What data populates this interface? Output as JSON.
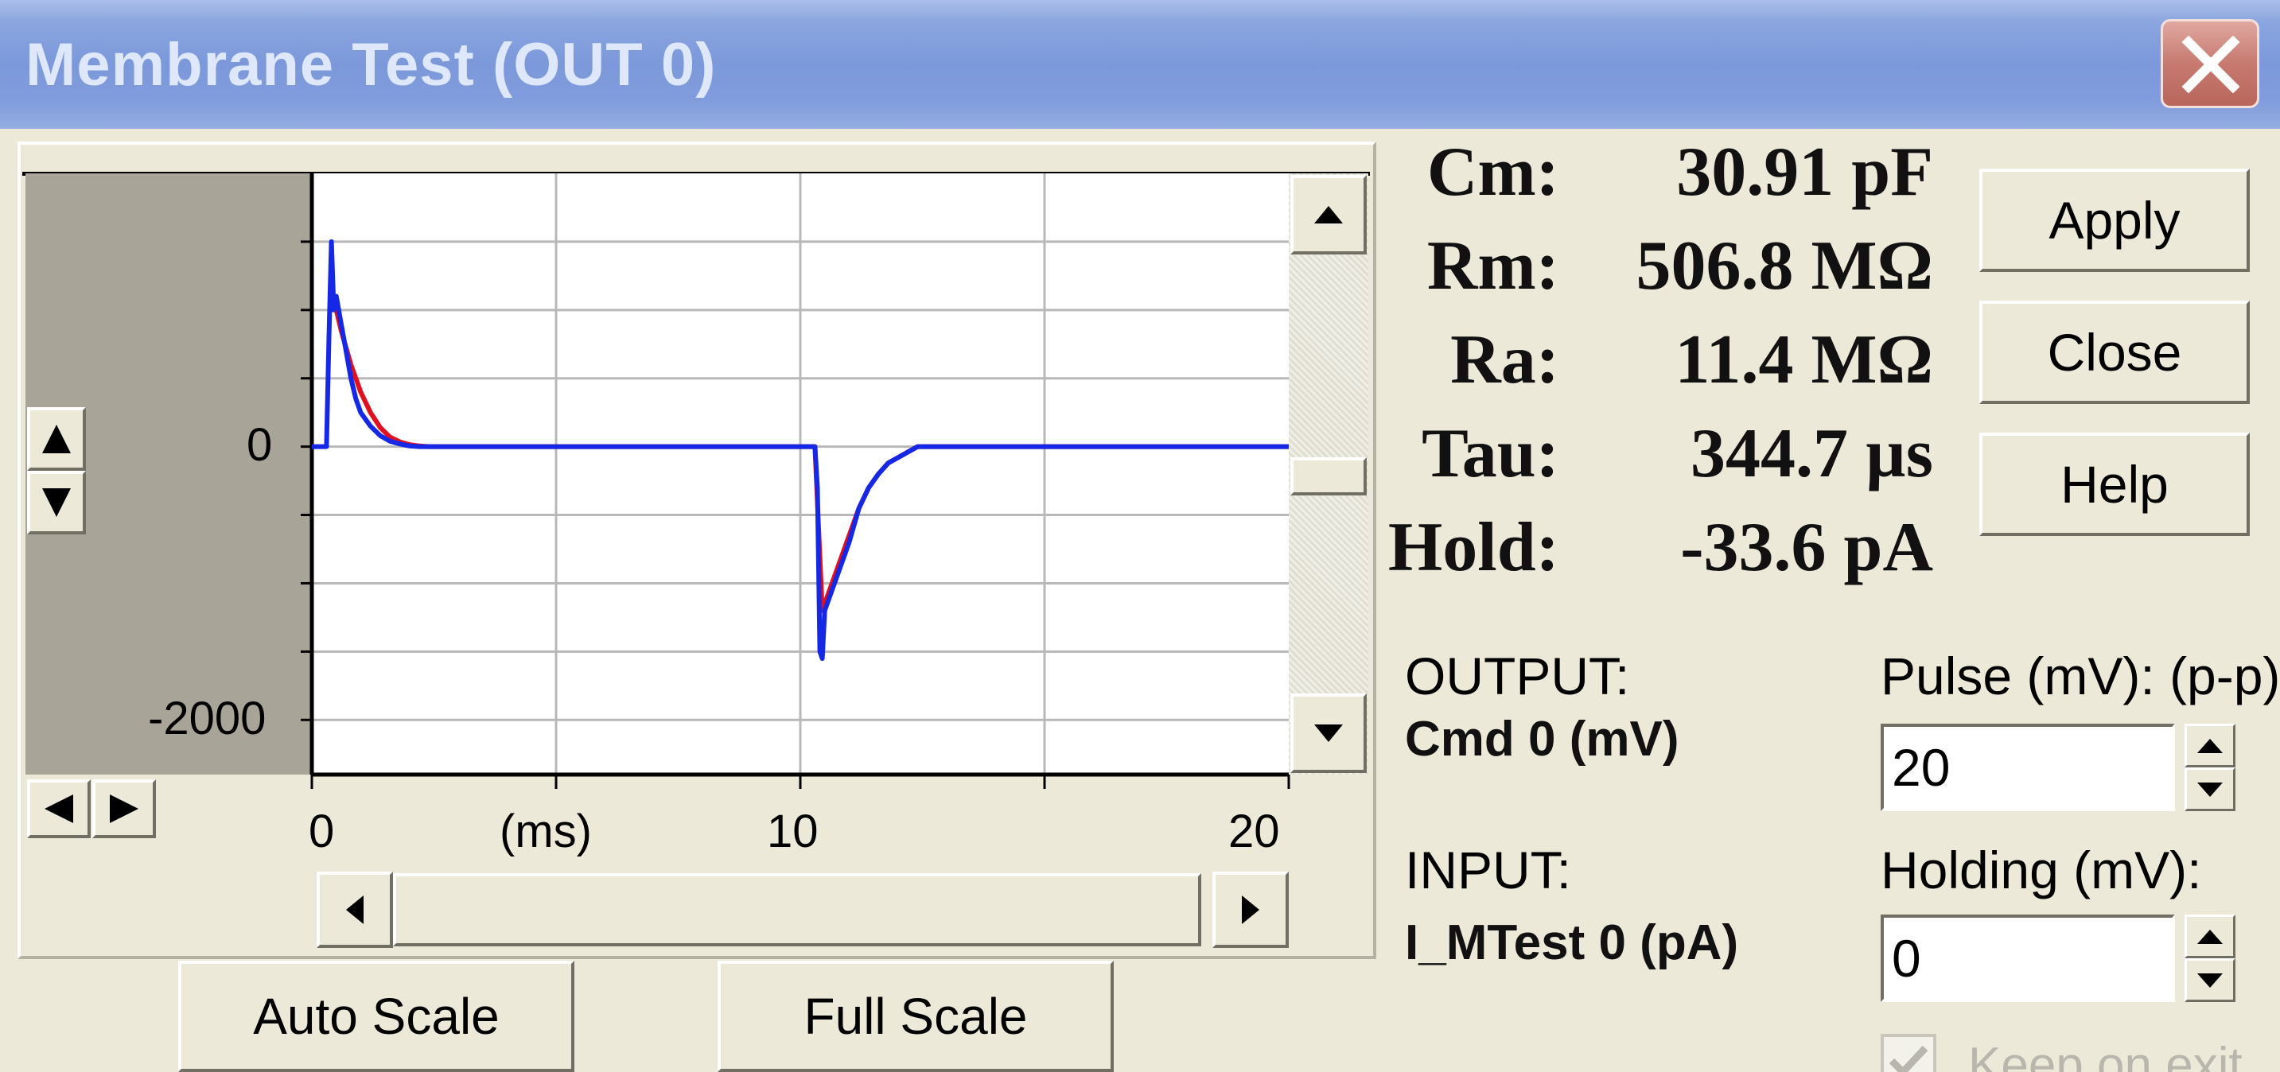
{
  "window": {
    "title": "Membrane Test (OUT 0)"
  },
  "plot": {
    "y_ticks": [
      "0",
      "-2000"
    ],
    "x_ticks": [
      "0",
      "10",
      "20"
    ],
    "x_unit": "(ms)"
  },
  "buttons": {
    "auto_scale": "Auto Scale",
    "full_scale": "Full Scale",
    "apply": "Apply",
    "close": "Close",
    "help": "Help"
  },
  "stats": [
    {
      "label": "Cm:",
      "value": "30.91 pF"
    },
    {
      "label": "Rm:",
      "value": "506.8 MΩ"
    },
    {
      "label": "Ra:",
      "value": "11.4 MΩ"
    },
    {
      "label": "Tau:",
      "value": "344.7 µs"
    },
    {
      "label": "Hold:",
      "value": "-33.6 pA"
    }
  ],
  "output": {
    "title": "OUTPUT:",
    "value": "Cmd 0 (mV)"
  },
  "input": {
    "title": "INPUT:",
    "value": "I_MTest 0 (pA)"
  },
  "pulse": {
    "label": "Pulse (mV): (p-p)",
    "value": "20"
  },
  "holding": {
    "label": "Holding (mV):",
    "value": "0"
  },
  "keep_on_exit": {
    "label": "Keep on exit",
    "checked": true
  },
  "colors": {
    "raw_trace": "#1428e6",
    "fit_trace": "#e01020",
    "title_bar": "#7b98da"
  },
  "chart_data": {
    "type": "line",
    "xlim": [
      0,
      20
    ],
    "ylim": [
      -2400,
      2000
    ],
    "grid": true,
    "series": [
      {
        "x": [
          0,
          0.3,
          0.35,
          0.4,
          0.45,
          0.5,
          0.6,
          0.7,
          0.8,
          0.9,
          1.0,
          1.2,
          1.4,
          1.6,
          1.8,
          2.0,
          2.2,
          2.4,
          8.8,
          10.0,
          10.3,
          10.35,
          10.4,
          10.45,
          10.5,
          10.6,
          10.8,
          11.0,
          11.2,
          11.4,
          11.6,
          11.8,
          12.0,
          12.2,
          12.4,
          20.0
        ],
        "y": [
          0,
          0,
          800,
          1500,
          1000,
          1100,
          900,
          700,
          500,
          350,
          250,
          150,
          80,
          40,
          20,
          5,
          0,
          0,
          0,
          0,
          0,
          -300,
          -1500,
          -1550,
          -1200,
          -1100,
          -900,
          -700,
          -450,
          -300,
          -200,
          -120,
          -80,
          -40,
          0,
          0
        ]
      },
      {
        "x": [
          0.4,
          0.5,
          0.6,
          0.8,
          1.0,
          1.2,
          1.4,
          1.6,
          1.8,
          2.0,
          2.2,
          2.4,
          8.8,
          10.3,
          10.45,
          10.6,
          10.8,
          11.0,
          11.2,
          11.4,
          11.6,
          11.8,
          12.0,
          12.2,
          12.4,
          18.9,
          20.0
        ],
        "y": [
          1150,
          1000,
          850,
          600,
          400,
          250,
          140,
          70,
          35,
          15,
          5,
          0,
          0,
          0,
          -1200,
          -1050,
          -850,
          -650,
          -450,
          -300,
          -200,
          -120,
          -80,
          -40,
          0,
          0,
          0
        ]
      }
    ]
  }
}
